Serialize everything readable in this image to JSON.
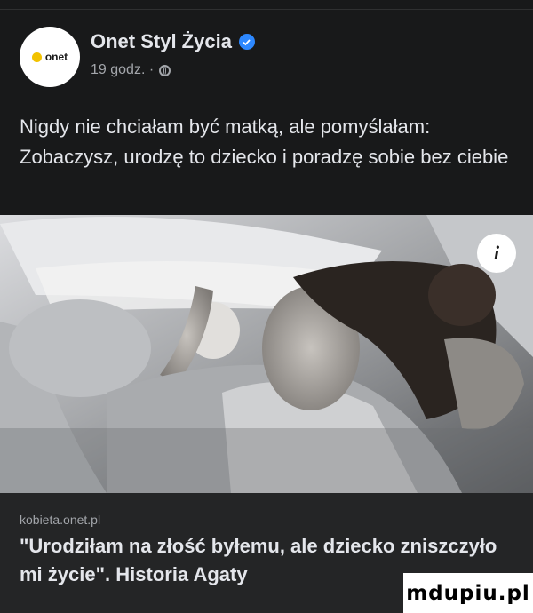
{
  "post": {
    "page_name": "Onet Styl Życia",
    "time": "19 godz. ·",
    "text": "Nigdy nie chciałam być matką, ale pomyślałam: Zobaczysz, urodzę to dziecko i poradzę sobie bez ciebie",
    "avatar_logo_text": "onet",
    "icons": {
      "verified": "verified-badge-icon",
      "privacy": "globe-icon",
      "info": "info-icon"
    }
  },
  "link": {
    "domain": "kobieta.onet.pl",
    "title": "\"Urodziłam na złość byłemu, ale dziecko zniszczyło mi życie\". Historia Agaty"
  },
  "watermark": {
    "text": "mdupiu.pl"
  },
  "colors": {
    "background": "#18191a",
    "card": "#242526",
    "text": "#e4e6eb",
    "muted": "#a3a6ab",
    "verified": "#2d88ff",
    "logo_dot": "#f2c200"
  }
}
